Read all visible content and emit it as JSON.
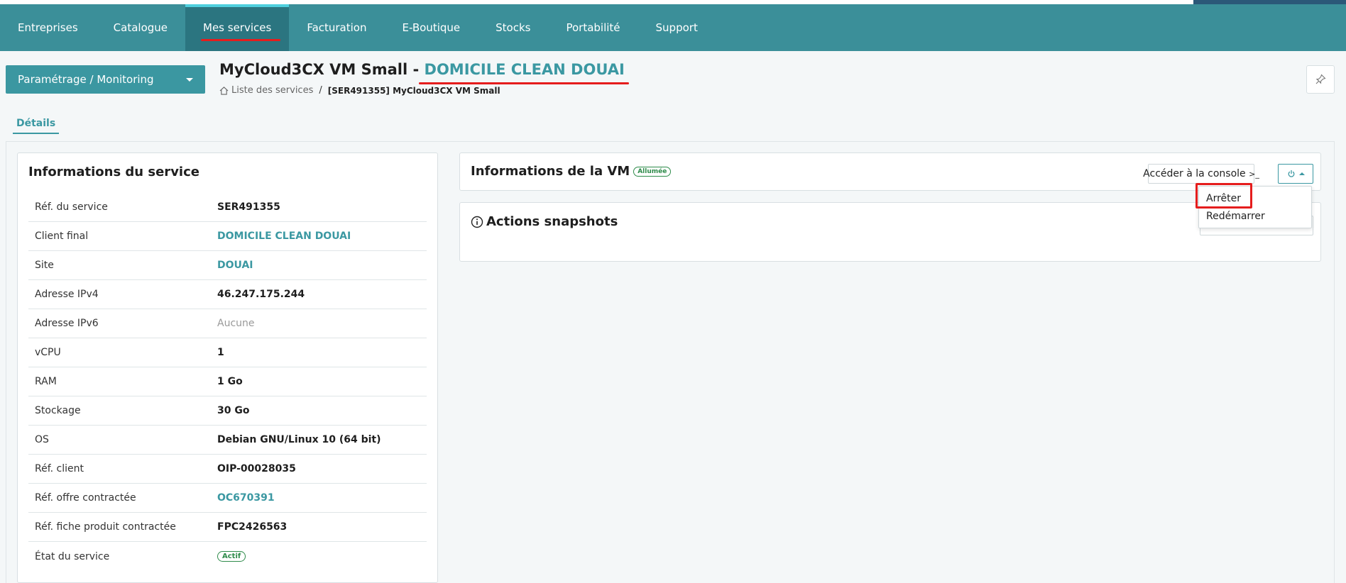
{
  "nav": {
    "items": [
      "Entreprises",
      "Catalogue",
      "Mes services",
      "Facturation",
      "E-Boutique",
      "Stocks",
      "Portabilité",
      "Support"
    ],
    "active": "Mes services"
  },
  "dropdown": {
    "label": "Paramétrage / Monitoring"
  },
  "page": {
    "title_prefix": "MyCloud3CX VM Small - ",
    "title_link": "DOMICILE CLEAN DOUAI"
  },
  "breadcrumb": {
    "parent": "Liste des services",
    "separator": "/",
    "current": "[SER491355] MyCloud3CX VM Small"
  },
  "tabs": {
    "details": "Détails"
  },
  "service_info": {
    "title": "Informations du service",
    "rows": [
      {
        "label": "Réf. du service",
        "value": "SER491355"
      },
      {
        "label": "Client final",
        "value": "DOMICILE CLEAN DOUAI"
      },
      {
        "label": "Site",
        "value": "DOUAI"
      },
      {
        "label": "Adresse IPv4",
        "value": "46.247.175.244"
      },
      {
        "label": "Adresse IPv6",
        "value": "Aucune"
      },
      {
        "label": "vCPU",
        "value": "1"
      },
      {
        "label": "RAM",
        "value": "1 Go"
      },
      {
        "label": "Stockage",
        "value": "30 Go"
      },
      {
        "label": "OS",
        "value": "Debian GNU/Linux 10 (64 bit)"
      },
      {
        "label": "Réf. client",
        "value": "OIP-00028035"
      },
      {
        "label": "Réf. offre contractée",
        "value": "OC670391"
      },
      {
        "label": "Réf. fiche produit contractée",
        "value": "FPC2426563"
      },
      {
        "label": "État du service",
        "value": "Actif"
      }
    ]
  },
  "vm_info": {
    "title": "Informations de la VM",
    "status": "Allumée",
    "console_label": "Accéder à la console",
    "console_icon": ">_"
  },
  "power_menu": {
    "items": [
      "Arrêter",
      "Redémarrer"
    ]
  },
  "snapshots": {
    "title": "Actions snapshots"
  },
  "colors": {
    "primary": "#3b8f99",
    "primary_dark": "#2b7580",
    "link": "#3b98a2",
    "highlight": "#e51d1d",
    "success": "#2e8b4a"
  }
}
